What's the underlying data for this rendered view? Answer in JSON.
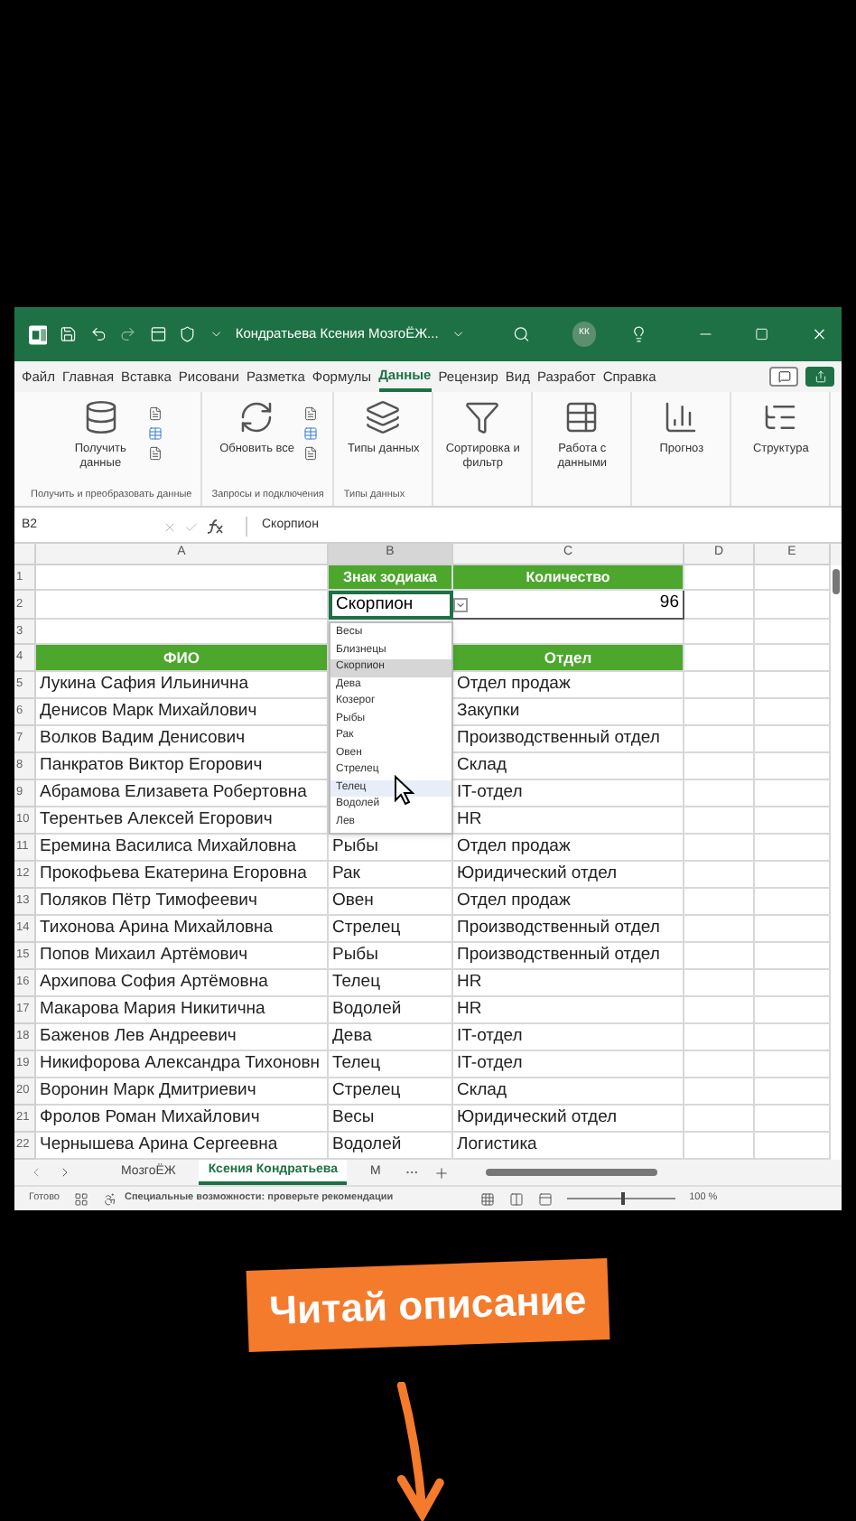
{
  "window": {
    "title": "Кондратьева Ксения МозгоЁЖ...",
    "avatar": "КК"
  },
  "menu_tabs": [
    {
      "label": "Файл",
      "selected": false
    },
    {
      "label": "Главная",
      "selected": false
    },
    {
      "label": "Вставка",
      "selected": false
    },
    {
      "label": "Рисовани",
      "selected": false
    },
    {
      "label": "Разметка",
      "selected": false
    },
    {
      "label": "Формулы",
      "selected": false
    },
    {
      "label": "Данные",
      "selected": true
    },
    {
      "label": "Рецензир",
      "selected": false
    },
    {
      "label": "Вид",
      "selected": false
    },
    {
      "label": "Разработ",
      "selected": false
    },
    {
      "label": "Справка",
      "selected": false
    }
  ],
  "ribbon": {
    "groups": [
      {
        "label": "Получить и преобразовать данные",
        "buttons": [
          {
            "label": "Получить данные",
            "kind": "get-data"
          }
        ]
      },
      {
        "label": "Запросы и подключения",
        "buttons": [
          {
            "label": "Обновить все",
            "kind": "refresh"
          }
        ]
      },
      {
        "label": "Типы данных",
        "buttons": [
          {
            "label": "Типы данных",
            "kind": "data-types"
          }
        ]
      },
      {
        "buttons": [
          {
            "label": "Сортировка и фильтр",
            "kind": "sort-filter"
          }
        ]
      },
      {
        "buttons": [
          {
            "label": "Работа с данными",
            "kind": "data-tools"
          }
        ]
      },
      {
        "buttons": [
          {
            "label": "Прогноз",
            "kind": "forecast"
          }
        ]
      },
      {
        "buttons": [
          {
            "label": "Структура",
            "kind": "outline"
          }
        ]
      }
    ]
  },
  "formula_bar": {
    "name_box": "B2",
    "formula": "Скорпион"
  },
  "sheet": {
    "columns": [
      "A",
      "B",
      "C",
      "D",
      "E"
    ],
    "row_numbers": [
      "1",
      "2",
      "3",
      "4",
      "5",
      "6",
      "7",
      "8",
      "9",
      "10",
      "11",
      "12",
      "13",
      "14",
      "15",
      "16",
      "17",
      "18",
      "19",
      "20",
      "21",
      "22"
    ],
    "row_1": {
      "b": "Знак зодиака",
      "c": "Количество"
    },
    "row_2": {
      "b": "Скорпион",
      "c": "96"
    },
    "header_row": {
      "a": "ФИО",
      "c": "Отдел"
    },
    "rows": [
      {
        "fio": "Лукина Сафия Ильинична",
        "dept": "Отдел продаж"
      },
      {
        "fio": "Денисов Марк Михайлович",
        "dept": "Закупки"
      },
      {
        "fio": "Волков Вадим Денисович",
        "dept": "Производственный отдел"
      },
      {
        "fio": "Панкратов Виктор Егорович",
        "dept": "Склад"
      },
      {
        "fio": "Абрамова Елизавета Робертовна",
        "dept": "IT-отдел"
      },
      {
        "fio": "Терентьев Алексей Егорович",
        "dept": "HR"
      },
      {
        "fio": "Еремина Василиса Михайловна",
        "sign": "Рыбы",
        "dept": "Отдел продаж"
      },
      {
        "fio": "Прокофьева Екатерина Егоровна",
        "sign": "Рак",
        "dept": "Юридический отдел"
      },
      {
        "fio": "Поляков Пётр Тимофеевич",
        "sign": "Овен",
        "dept": "Отдел продаж"
      },
      {
        "fio": "Тихонова Арина Михайловна",
        "sign": "Стрелец",
        "dept": "Производственный отдел"
      },
      {
        "fio": "Попов Михаил Артёмович",
        "sign": "Рыбы",
        "dept": "Производственный отдел"
      },
      {
        "fio": "Архипова София Артёмовна",
        "sign": "Телец",
        "dept": "HR"
      },
      {
        "fio": "Макарова Мария Никитична",
        "sign": "Водолей",
        "dept": "HR"
      },
      {
        "fio": "Баженов Лев Андреевич",
        "sign": "Дева",
        "dept": "IT-отдел"
      },
      {
        "fio": "Никифорова Александра Тихоновн",
        "sign": "Телец",
        "dept": "IT-отдел"
      },
      {
        "fio": "Воронин Марк Дмитриевич",
        "sign": "Стрелец",
        "dept": "Склад"
      },
      {
        "fio": "Фролов Роман Михайлович",
        "sign": "Весы",
        "dept": "Юридический отдел"
      },
      {
        "fio": "Чернышева Арина Сергеевна",
        "sign": "Водолей",
        "dept": "Логистика"
      }
    ]
  },
  "dropdown": {
    "items": [
      {
        "label": "Весы",
        "selected": false,
        "hovered": false
      },
      {
        "label": "Близнецы",
        "selected": false,
        "hovered": false
      },
      {
        "label": "Скорпион",
        "selected": true,
        "hovered": false
      },
      {
        "label": "Дева",
        "selected": false,
        "hovered": false
      },
      {
        "label": "Козерог",
        "selected": false,
        "hovered": false
      },
      {
        "label": "Рыбы",
        "selected": false,
        "hovered": false
      },
      {
        "label": "Рак",
        "selected": false,
        "hovered": false
      },
      {
        "label": "Овен",
        "selected": false,
        "hovered": false
      },
      {
        "label": "Стрелец",
        "selected": false,
        "hovered": false
      },
      {
        "label": "Телец",
        "selected": false,
        "hovered": true
      },
      {
        "label": "Водолей",
        "selected": false,
        "hovered": false
      },
      {
        "label": "Лев",
        "selected": false,
        "hovered": false
      }
    ]
  },
  "sheet_tabs": [
    {
      "label": "МозгоЁЖ",
      "selected": false
    },
    {
      "label": "Ксения Кондратьева",
      "selected": true
    },
    {
      "label": "М",
      "selected": false
    }
  ],
  "status_bar": {
    "status": "Готово",
    "accessibility": "Специальные возможности: проверьте рекомендации",
    "zoom": "100 %",
    "zoom_slider": {
      "level": 0.5
    }
  },
  "overlay": {
    "caption": "Читай описание"
  }
}
